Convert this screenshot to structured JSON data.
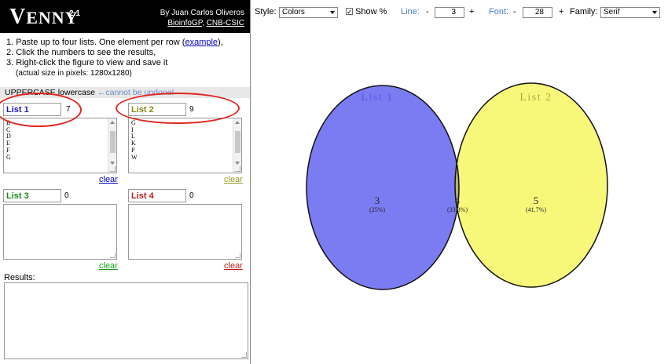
{
  "header": {
    "logo_big": "V",
    "logo_rest": "ENNY",
    "version": "2.1",
    "author": "By Juan Carlos Oliveros",
    "link1": "BioinfoGP",
    "link_sep": ",",
    "link2": "CNB-CSIC"
  },
  "instructions": {
    "line1_prefix": "1. Paste up to four lists. One element per row (",
    "line1_link": "example",
    "line1_suffix": "),",
    "line2": "2. Click the numbers to see the results,",
    "line3": "3. Right-click the figure to view and save it",
    "note": "(actual size in pixels: 1280x1280)"
  },
  "casebar": {
    "upper": "UPPERCASE",
    "lower": "lowercase",
    "warning": "←cannot be undone!"
  },
  "lists": [
    {
      "label": "List 1",
      "count": "7",
      "color": "#1a1ab0",
      "items": [
        "B",
        "C",
        "D",
        "E",
        "F",
        "G"
      ],
      "clear": "clear",
      "clear_color": "#00c"
    },
    {
      "label": "List 2",
      "count": "9",
      "color": "#8a8a1a",
      "items": [
        "G",
        "I",
        "L",
        "K",
        "P",
        "W"
      ],
      "clear": "clear",
      "clear_color": "#9a9a2a"
    },
    {
      "label": "List 3",
      "count": "0",
      "color": "#1a8a1a",
      "items": [],
      "clear": "clear",
      "clear_color": "#1a9a1a"
    },
    {
      "label": "List 4",
      "count": "0",
      "color": "#c01a1a",
      "items": [],
      "clear": "clear",
      "clear_color": "#c01a1a"
    }
  ],
  "results_label": "Results:",
  "toolbar": {
    "style_label": "Style:",
    "style_value": "Colors",
    "show_pct_label": "Show %",
    "show_pct_checked": true,
    "line_label": "Line:",
    "line_value": "3",
    "font_label": "Font:",
    "font_value": "28",
    "minus": "-",
    "plus": "+",
    "family_label": "Family:",
    "family_value": "Serif"
  },
  "venn": {
    "list1_title": "List 1",
    "list2_title": "List 2",
    "list1_color": "#7b7bf2",
    "list2_color": "#f7f77a",
    "overlap_color": "#b3b37a",
    "list1_title_color": "#5a5ae8",
    "list2_title_color": "#b0a84a",
    "only1_count": "3",
    "only1_pct": "(25%)",
    "both_count": "4",
    "both_pct": "(33.3%)",
    "only2_count": "5",
    "only2_pct": "(41.7%)"
  }
}
